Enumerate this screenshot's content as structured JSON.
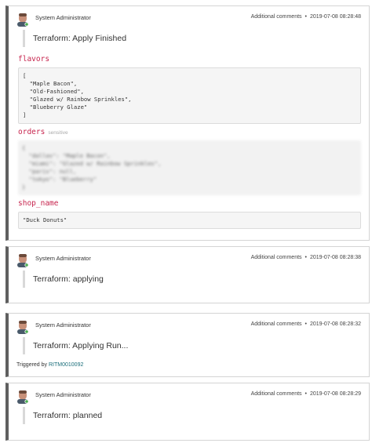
{
  "entries": [
    {
      "user": "System Administrator",
      "type": "Additional comments",
      "time": "2019-07-08 08:28:48",
      "title": "Terraform: Apply Finished"
    },
    {
      "user": "System Administrator",
      "type": "Additional comments",
      "time": "2019-07-08 08:28:38",
      "title": "Terraform: applying"
    },
    {
      "user": "System Administrator",
      "type": "Additional comments",
      "time": "2019-07-08 08:28:32",
      "title": "Terraform: Applying Run...",
      "triggered_label": "Triggered by",
      "triggered_link": "RITM0010092"
    },
    {
      "user": "System Administrator",
      "type": "Additional comments",
      "time": "2019-07-08 08:28:29",
      "title": "Terraform: planned"
    }
  ],
  "separator": "•",
  "outputs": {
    "flavors": {
      "name": "flavors",
      "value": "[\n  \"Maple Bacon\",\n  \"Old-Fashioned\",\n  \"Glazed w/ Rainbow Sprinkles\",\n  \"Blueberry Glaze\"\n]"
    },
    "orders": {
      "name": "orders",
      "sensitive_label": "sensitive",
      "value": "{\n  \"dallas\": \"Maple Bacon\",\n  \"miami\": \"Glazed w/ Rainbow Sprinkles\",\n  \"paris\": null,\n  \"tokyo\": \"Blueberry\"\n}"
    },
    "shop_name": {
      "name": "shop_name",
      "value": "\"Duck Donuts\""
    }
  }
}
